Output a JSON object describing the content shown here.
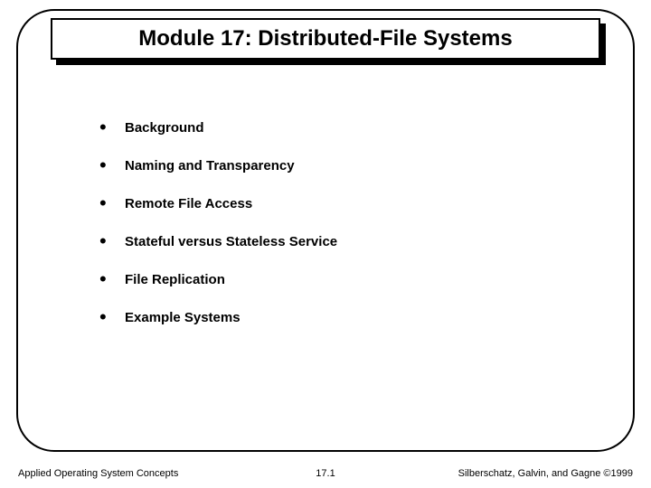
{
  "title": "Module 17:  Distributed-File Systems",
  "bullets": [
    "Background",
    "Naming and Transparency",
    "Remote File Access",
    "Stateful versus Stateless Service",
    "File Replication",
    "Example Systems"
  ],
  "footer": {
    "left": "Applied Operating System Concepts",
    "center": "17.1",
    "right": "Silberschatz, Galvin, and Gagne ©1999"
  }
}
